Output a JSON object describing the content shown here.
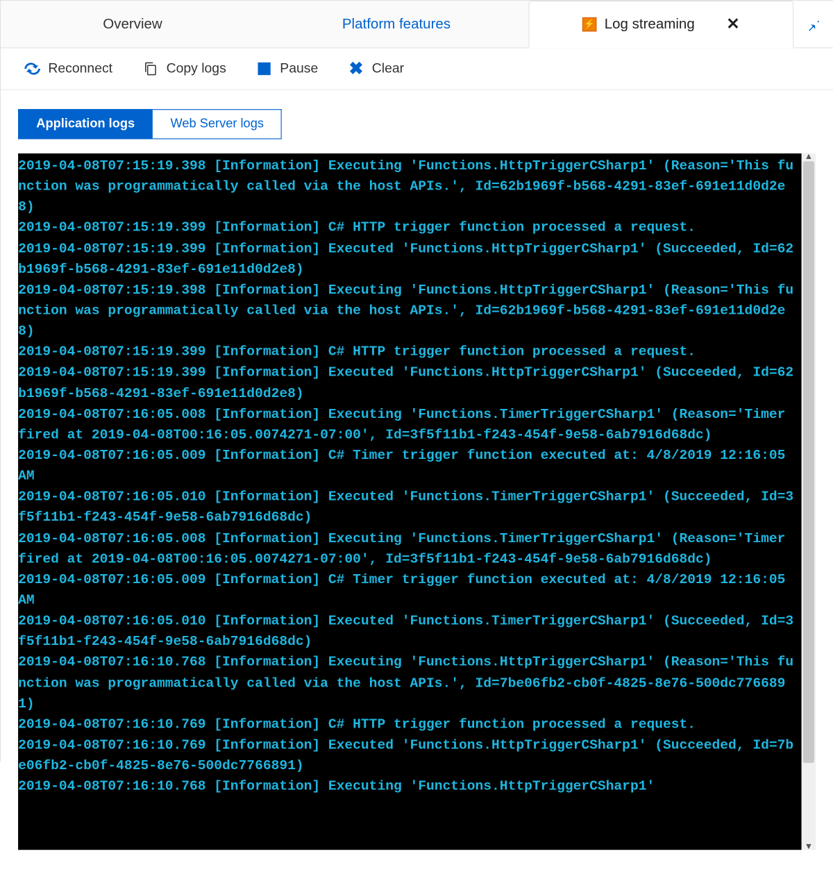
{
  "tabs": {
    "overview": "Overview",
    "platform": "Platform features",
    "logstream": "Log streaming"
  },
  "toolbar": {
    "reconnect": "Reconnect",
    "copy": "Copy logs",
    "pause": "Pause",
    "clear": "Clear"
  },
  "subtabs": {
    "app": "Application logs",
    "web": "Web Server logs"
  },
  "log_lines": [
    "2019-04-08T07:15:19.398 [Information] Executing 'Functions.HttpTriggerCSharp1' (Reason='This function was programmatically called via the host APIs.', Id=62b1969f-b568-4291-83ef-691e11d0d2e8)",
    "2019-04-08T07:15:19.399 [Information] C# HTTP trigger function processed a request.",
    "2019-04-08T07:15:19.399 [Information] Executed 'Functions.HttpTriggerCSharp1' (Succeeded, Id=62b1969f-b568-4291-83ef-691e11d0d2e8)",
    "2019-04-08T07:15:19.398 [Information] Executing 'Functions.HttpTriggerCSharp1' (Reason='This function was programmatically called via the host APIs.', Id=62b1969f-b568-4291-83ef-691e11d0d2e8)",
    "2019-04-08T07:15:19.399 [Information] C# HTTP trigger function processed a request.",
    "2019-04-08T07:15:19.399 [Information] Executed 'Functions.HttpTriggerCSharp1' (Succeeded, Id=62b1969f-b568-4291-83ef-691e11d0d2e8)",
    "2019-04-08T07:16:05.008 [Information] Executing 'Functions.TimerTriggerCSharp1' (Reason='Timer fired at 2019-04-08T00:16:05.0074271-07:00', Id=3f5f11b1-f243-454f-9e58-6ab7916d68dc)",
    "2019-04-08T07:16:05.009 [Information] C# Timer trigger function executed at: 4/8/2019 12:16:05 AM",
    "2019-04-08T07:16:05.010 [Information] Executed 'Functions.TimerTriggerCSharp1' (Succeeded, Id=3f5f11b1-f243-454f-9e58-6ab7916d68dc)",
    "2019-04-08T07:16:05.008 [Information] Executing 'Functions.TimerTriggerCSharp1' (Reason='Timer fired at 2019-04-08T00:16:05.0074271-07:00', Id=3f5f11b1-f243-454f-9e58-6ab7916d68dc)",
    "2019-04-08T07:16:05.009 [Information] C# Timer trigger function executed at: 4/8/2019 12:16:05 AM",
    "2019-04-08T07:16:05.010 [Information] Executed 'Functions.TimerTriggerCSharp1' (Succeeded, Id=3f5f11b1-f243-454f-9e58-6ab7916d68dc)",
    "2019-04-08T07:16:10.768 [Information] Executing 'Functions.HttpTriggerCSharp1' (Reason='This function was programmatically called via the host APIs.', Id=7be06fb2-cb0f-4825-8e76-500dc7766891)",
    "2019-04-08T07:16:10.769 [Information] C# HTTP trigger function processed a request.",
    "2019-04-08T07:16:10.769 [Information] Executed 'Functions.HttpTriggerCSharp1' (Succeeded, Id=7be06fb2-cb0f-4825-8e76-500dc7766891)",
    "2019-04-08T07:16:10.768 [Information] Executing 'Functions.HttpTriggerCSharp1'"
  ]
}
